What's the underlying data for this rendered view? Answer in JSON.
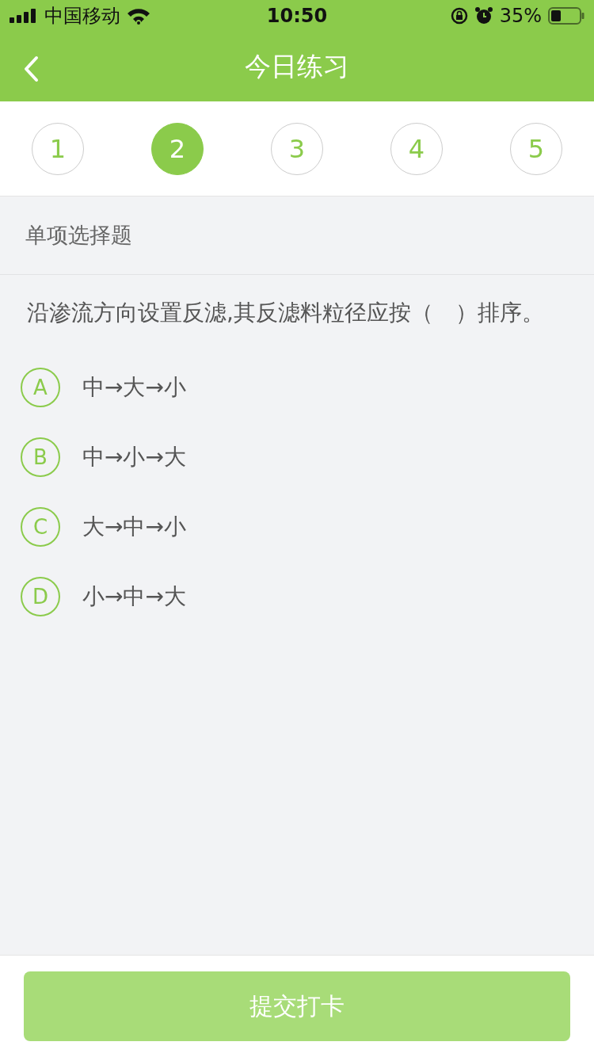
{
  "status_bar": {
    "carrier": "中国移动",
    "time": "10:50",
    "battery": "35%"
  },
  "nav": {
    "title": "今日练习"
  },
  "steps": [
    {
      "label": "1",
      "selected": false
    },
    {
      "label": "2",
      "selected": true
    },
    {
      "label": "3",
      "selected": false
    },
    {
      "label": "4",
      "selected": false
    },
    {
      "label": "5",
      "selected": false
    }
  ],
  "section": {
    "title": "单项选择题"
  },
  "question": {
    "text": "沿渗流方向设置反滤,其反滤料粒径应按（　）排序。"
  },
  "options": [
    {
      "letter": "A",
      "text": "中→大→小",
      "selected": false
    },
    {
      "letter": "B",
      "text": "中→小→大",
      "selected": false
    },
    {
      "letter": "C",
      "text": "大→中→小",
      "selected": false
    },
    {
      "letter": "D",
      "text": "小→中→大",
      "selected": false
    }
  ],
  "submit": {
    "label": "提交打卡",
    "disabled": true
  }
}
